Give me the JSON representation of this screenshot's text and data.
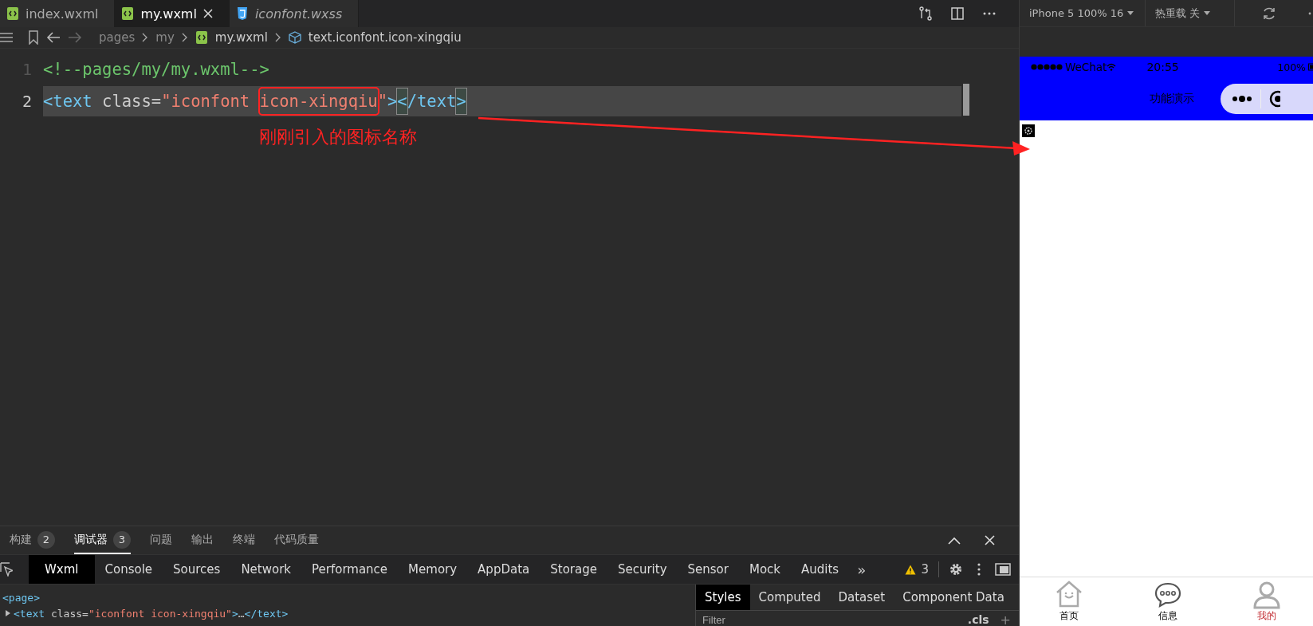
{
  "editor_tabs": [
    {
      "label": "index.wxml",
      "kind": "wxml",
      "selected": false,
      "preview": false
    },
    {
      "label": "my.wxml",
      "kind": "wxml",
      "selected": true,
      "preview": false
    },
    {
      "label": "iconfont.wxss",
      "kind": "css",
      "selected": false,
      "preview": true
    }
  ],
  "breadcrumb": [
    {
      "label": "pages",
      "kind": "folder"
    },
    {
      "label": "my",
      "kind": "folder"
    },
    {
      "label": "my.wxml",
      "kind": "file"
    },
    {
      "label": "text.iconfont.icon-xingqiu",
      "kind": "element"
    }
  ],
  "code_lines": [
    {
      "number": "1",
      "current": false,
      "tokens": [
        {
          "kind": "comment",
          "text": "<!--pages/my/my.wxml-->"
        }
      ]
    },
    {
      "number": "2",
      "current": true,
      "tokens": [
        {
          "kind": "tag",
          "text": "<text"
        },
        {
          "kind": "attr",
          "text": " class="
        },
        {
          "kind": "string",
          "text": "\"iconfont "
        },
        {
          "kind": "string",
          "text": "icon-xingqiu",
          "boxed": true
        },
        {
          "kind": "string",
          "text": "\""
        },
        {
          "kind": "tag",
          "text": ">"
        },
        {
          "kind": "tag",
          "text": "<",
          "matched": true
        },
        {
          "kind": "tag",
          "text": "/text"
        },
        {
          "kind": "tag",
          "text": ">",
          "matched": true
        }
      ]
    }
  ],
  "annotation": {
    "text": "刚刚引入的图标名称"
  },
  "panel_tabs": [
    {
      "label": "构建",
      "badge": "2",
      "selected": false
    },
    {
      "label": "调试器",
      "badge": "3",
      "selected": true
    },
    {
      "label": "问题",
      "selected": false
    },
    {
      "label": "输出",
      "selected": false
    },
    {
      "label": "终端",
      "selected": false
    },
    {
      "label": "代码质量",
      "selected": false
    }
  ],
  "devtools_tabs": [
    {
      "label": "Wxml",
      "selected": true
    },
    {
      "label": "Console",
      "selected": false
    },
    {
      "label": "Sources",
      "selected": false
    },
    {
      "label": "Network",
      "selected": false
    },
    {
      "label": "Performance",
      "selected": false
    },
    {
      "label": "Memory",
      "selected": false
    },
    {
      "label": "AppData",
      "selected": false
    },
    {
      "label": "Storage",
      "selected": false
    },
    {
      "label": "Security",
      "selected": false
    },
    {
      "label": "Sensor",
      "selected": false
    },
    {
      "label": "Mock",
      "selected": false
    },
    {
      "label": "Audits",
      "selected": false
    }
  ],
  "more_tabs": "»",
  "warnings": "3",
  "wxml_tree": [
    {
      "tokens": [
        {
          "kind": "tag",
          "text": "<page>"
        }
      ],
      "children": [
        {
          "expanded": false,
          "tokens": [
            {
              "kind": "tag",
              "text": "<text"
            },
            {
              "kind": "attr",
              "text": " class="
            },
            {
              "kind": "string",
              "text": "\"iconfont icon-xingqiu\""
            },
            {
              "kind": "tag",
              "text": ">"
            },
            {
              "kind": "attr",
              "text": "…"
            },
            {
              "kind": "tag",
              "text": "</text>"
            }
          ]
        }
      ]
    }
  ],
  "styles_tabs": [
    {
      "label": "Styles",
      "selected": true
    },
    {
      "label": "Computed",
      "selected": false
    },
    {
      "label": "Dataset",
      "selected": false
    },
    {
      "label": "Component Data",
      "selected": false
    }
  ],
  "styles_filter": {
    "placeholder": "Filter",
    "cls": ".cls",
    "add": "+"
  },
  "simulator": {
    "device": "iPhone 5 100% 16",
    "hot_reload": "热重载 关",
    "status_bar": {
      "carrier": "WeChat",
      "time": "20:55",
      "battery": "100%"
    },
    "nav_title": "功能演示",
    "tab_bar": [
      {
        "label": "首页",
        "kind": "home",
        "selected": false
      },
      {
        "label": "信息",
        "kind": "chat",
        "selected": false
      },
      {
        "label": "我的",
        "kind": "person",
        "selected": true
      }
    ]
  }
}
